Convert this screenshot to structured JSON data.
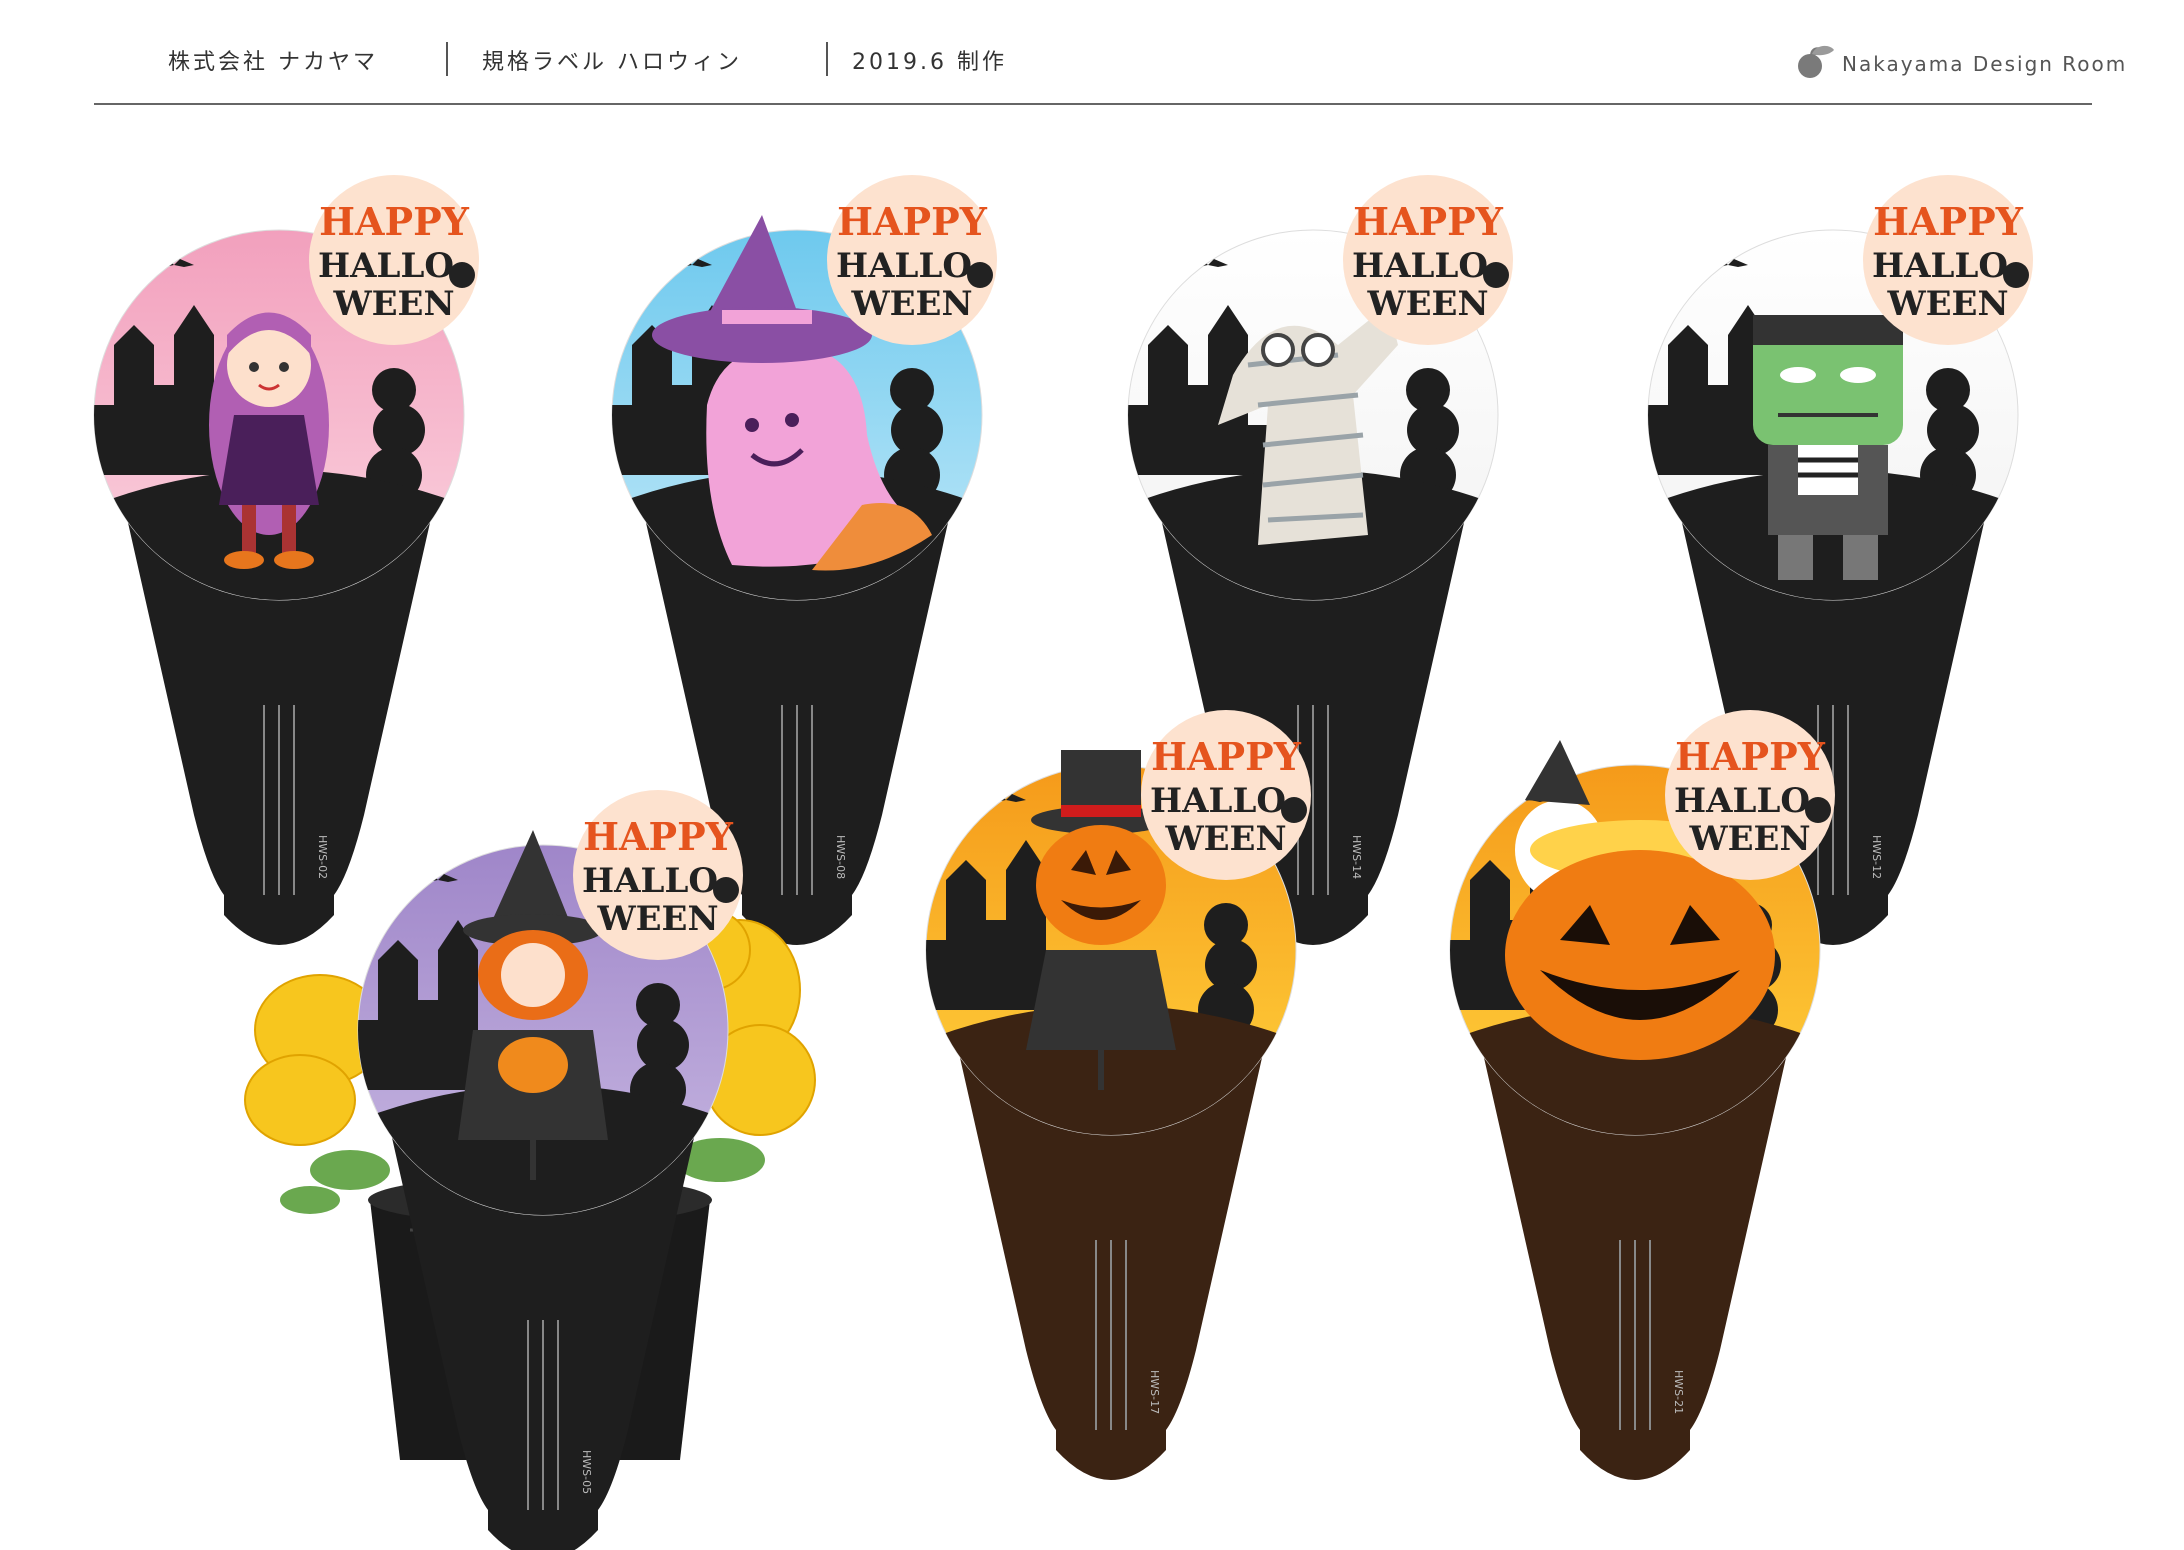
{
  "header": {
    "company": "株式会社 ナカヤマ",
    "title": "規格ラベル ハロウィン",
    "date": "2019.6 制作",
    "brand": "Nakayama Design Room",
    "logo_icon": "sprout-icon"
  },
  "badge_text": {
    "line1": "HAPPY",
    "line2": "HALLOWEEN"
  },
  "labels": [
    {
      "code": "HWS-02",
      "bg": "#f2a0bd",
      "bg2": "#fbd3df",
      "stick": "#1e1e1e",
      "character": "girl-with-purple-hair"
    },
    {
      "code": "HWS-08",
      "bg": "#6ec9ee",
      "bg2": "#bfe8f8",
      "stick": "#1e1e1e",
      "character": "pink-ghost-witch-hat"
    },
    {
      "code": "HWS-14",
      "bg": "#ffffff",
      "bg2": "#f2f2f2",
      "stick": "#1e1e1e",
      "character": "mummy"
    },
    {
      "code": "HWS-12",
      "bg": "#ffffff",
      "bg2": "#f2f2f2",
      "stick": "#1e1e1e",
      "character": "frankenstein"
    },
    {
      "code": "HWS-05",
      "bg": "#9f86c9",
      "bg2": "#c8b8e2",
      "stick": "#1e1e1e",
      "character": "witch-girl-with-pumpkin"
    },
    {
      "code": "HWS-17",
      "bg": "#f59a1a",
      "bg2": "#ffd23c",
      "stick": "#3b2313",
      "character": "pumpkin-head-top-hat"
    },
    {
      "code": "HWS-21",
      "bg": "#f59a1a",
      "bg2": "#ffd23c",
      "stick": "#3b2313",
      "character": "ghost-in-pumpkin-basket"
    }
  ]
}
